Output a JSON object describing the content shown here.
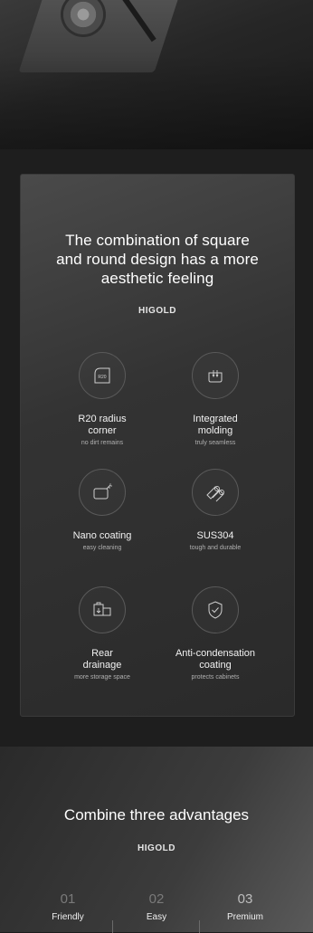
{
  "hero": {
    "image": "sink-drain-photo"
  },
  "card": {
    "title_lines": [
      "The combination of square",
      "and round design has a more",
      "aesthetic feeling"
    ],
    "brand": "HIGOLD",
    "features": [
      {
        "icon": "r20-corner-icon",
        "icon_text": "R20",
        "name_lines": [
          "R20 radius",
          "corner"
        ],
        "sub": "no dirt remains"
      },
      {
        "icon": "integrated-molding-icon",
        "name_lines": [
          "Integrated",
          "molding"
        ],
        "sub": "truly seamless"
      },
      {
        "icon": "nano-coating-icon",
        "name_lines": [
          "Nano coating"
        ],
        "sub": "easy cleaning"
      },
      {
        "icon": "steel-pipes-icon",
        "name_lines": [
          "SUS304"
        ],
        "sub": "tough and durable"
      },
      {
        "icon": "rear-drainage-icon",
        "name_lines": [
          "Rear",
          "drainage"
        ],
        "sub": "more storage space"
      },
      {
        "icon": "shield-check-icon",
        "name_lines": [
          "Anti-condensation",
          "coating"
        ],
        "sub": "protects cabinets"
      }
    ]
  },
  "advantages": {
    "title": "Combine three advantages",
    "brand": "HIGOLD",
    "items": [
      {
        "num": "01",
        "label": "Friendly"
      },
      {
        "num": "02",
        "label": "Easy"
      },
      {
        "num": "03",
        "label": "Premium"
      }
    ]
  }
}
